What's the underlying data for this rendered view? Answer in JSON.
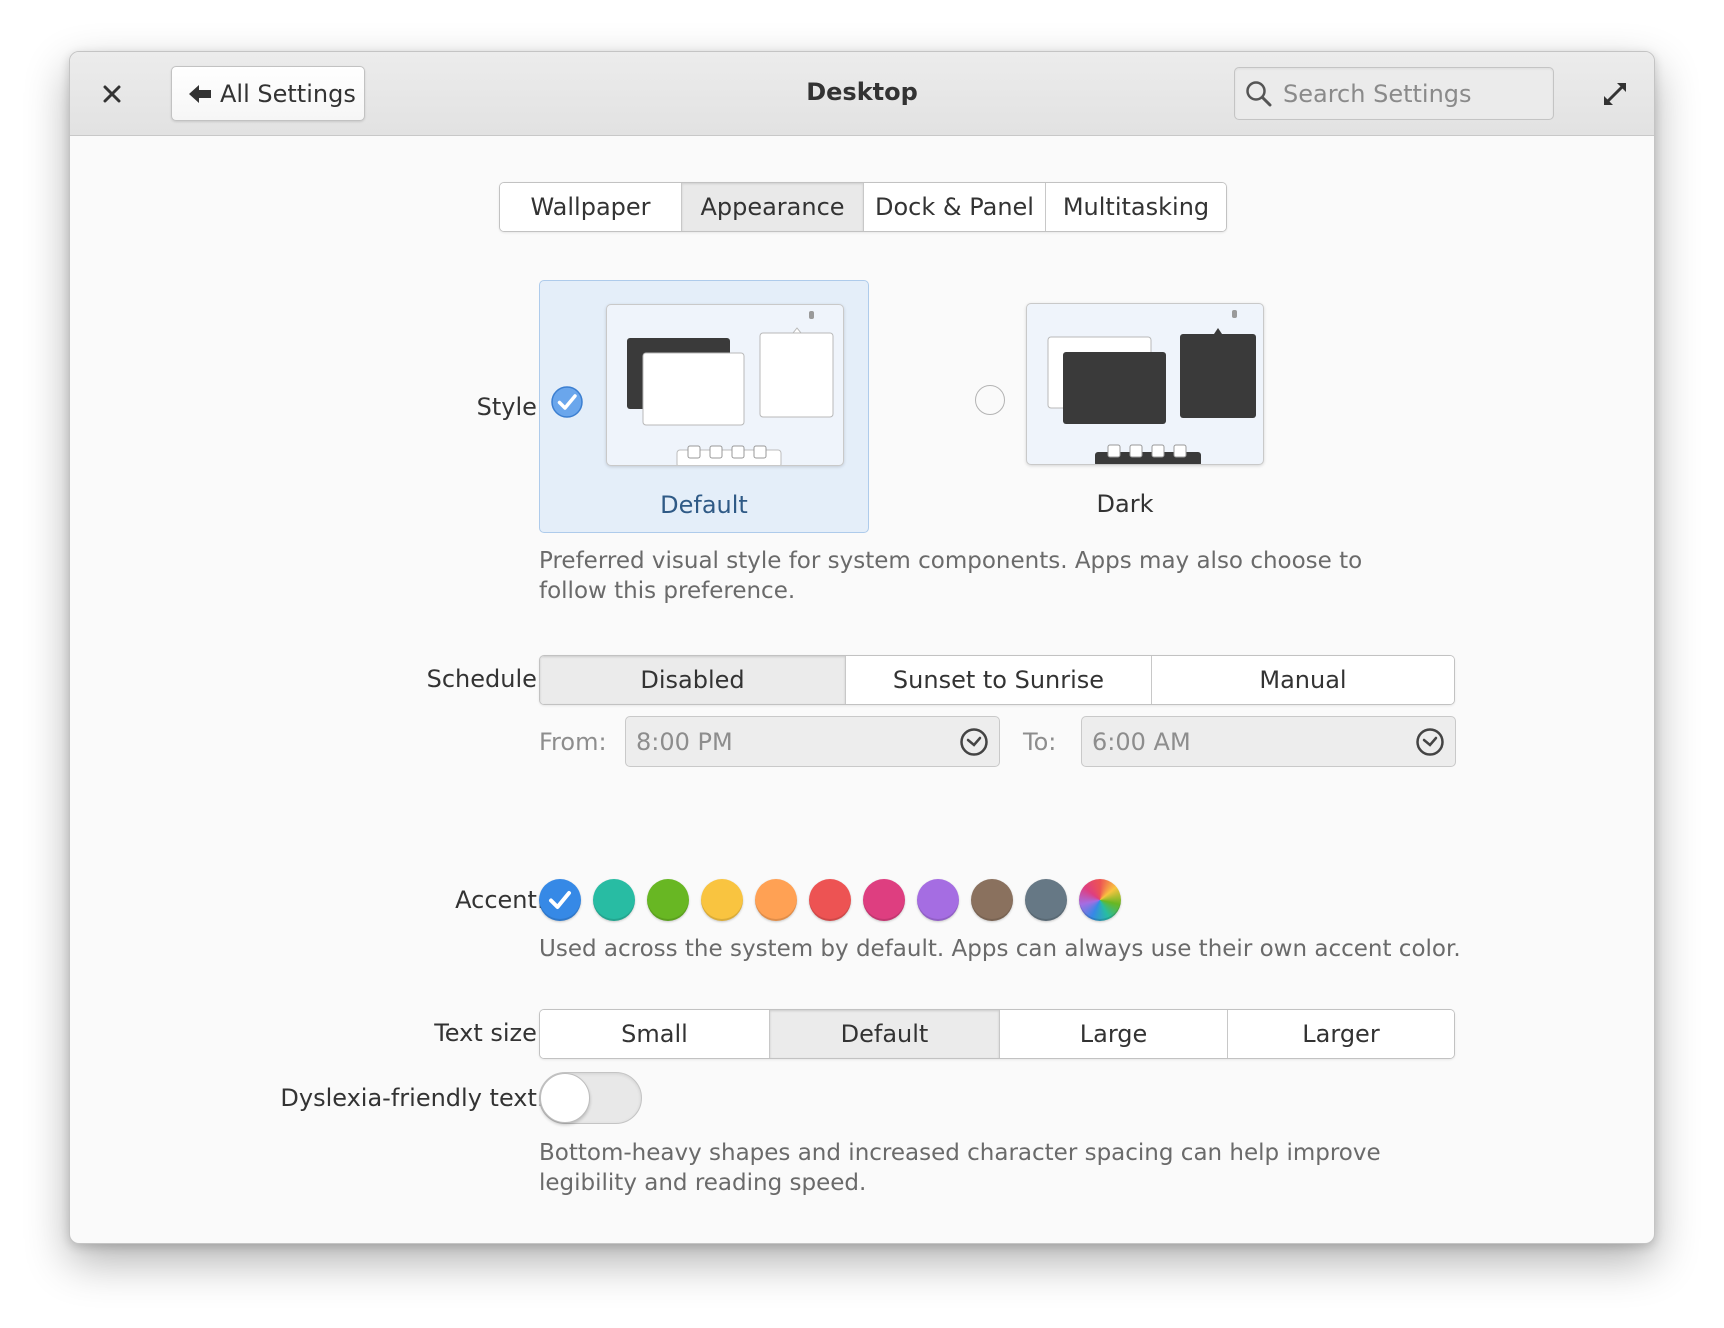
{
  "header": {
    "title": "Desktop",
    "back_label": "All Settings",
    "search_placeholder": "Search Settings"
  },
  "tabs": [
    {
      "label": "Wallpaper",
      "active": false
    },
    {
      "label": "Appearance",
      "active": true
    },
    {
      "label": "Dock & Panel",
      "active": false
    },
    {
      "label": "Multitasking",
      "active": false
    }
  ],
  "style": {
    "label": "Style:",
    "options": [
      {
        "label": "Default",
        "selected": true
      },
      {
        "label": "Dark",
        "selected": false
      }
    ],
    "description": "Preferred visual style for system components. Apps may also choose to follow this preference."
  },
  "schedule": {
    "label": "Schedule:",
    "options": [
      {
        "label": "Disabled",
        "active": true
      },
      {
        "label": "Sunset to Sunrise",
        "active": false
      },
      {
        "label": "Manual",
        "active": false
      }
    ],
    "from_label": "From:",
    "from_value": "8:00 PM",
    "to_label": "To:",
    "to_value": "6:00 AM"
  },
  "accent": {
    "label": "Accent:",
    "colors": [
      "#3689e6",
      "#28bca3",
      "#68b723",
      "#f9c440",
      "#ffa154",
      "#ed5353",
      "#de3e80",
      "#a56de2",
      "#8a715e",
      "#667885",
      "multicolor"
    ],
    "selected_index": 0,
    "description": "Used across the system by default. Apps can always use their own accent color."
  },
  "text_size": {
    "label": "Text size:",
    "options": [
      {
        "label": "Small",
        "active": false
      },
      {
        "label": "Default",
        "active": true
      },
      {
        "label": "Large",
        "active": false
      },
      {
        "label": "Larger",
        "active": false
      }
    ]
  },
  "dyslexia": {
    "label": "Dyslexia-friendly text:",
    "enabled": false,
    "description": "Bottom-heavy shapes and increased character spacing can help improve legibility and reading speed."
  },
  "colors": {
    "selection_bg": "#e4eef9",
    "selection_text": "#2f5a86",
    "check_blue": "#3689e6"
  }
}
